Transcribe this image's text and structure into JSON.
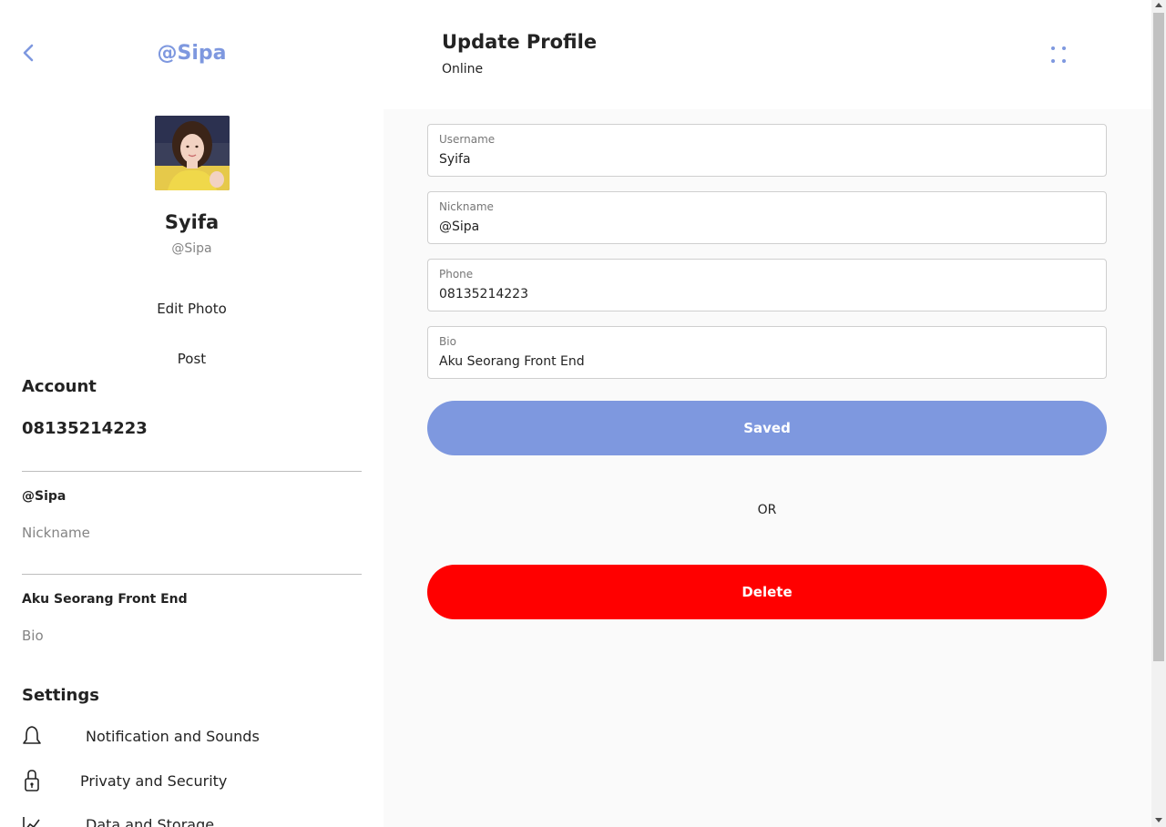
{
  "sidebar": {
    "handle": "@Sipa",
    "profile_name": "Syifa",
    "profile_handle": "@Sipa",
    "edit_photo_label": "Edit Photo",
    "post_label": "Post",
    "account_title": "Account",
    "account_phone": "08135214223",
    "nickname_value": "@Sipa",
    "nickname_label": "Nickname",
    "bio_value": "Aku Seorang Front End",
    "bio_label": "Bio",
    "settings_title": "Settings",
    "settings_items": [
      {
        "label": "Notification and Sounds",
        "icon": "bell-icon"
      },
      {
        "label": "Privaty and Security",
        "icon": "lock-icon"
      },
      {
        "label": "Data and Storage",
        "icon": "chart-icon"
      }
    ]
  },
  "header": {
    "title": "Update Profile",
    "status": "Online"
  },
  "form": {
    "username": {
      "label": "Username",
      "value": "Syifa"
    },
    "nickname": {
      "label": "Nickname",
      "value": "@Sipa"
    },
    "phone": {
      "label": "Phone",
      "value": "08135214223"
    },
    "bio": {
      "label": "Bio",
      "value": "Aku Seorang Front End"
    },
    "save_label": "Saved",
    "or_label": "OR",
    "delete_label": "Delete"
  },
  "colors": {
    "accent": "#7e98df",
    "danger": "#ff0000",
    "panel_bg": "#fafafa"
  }
}
